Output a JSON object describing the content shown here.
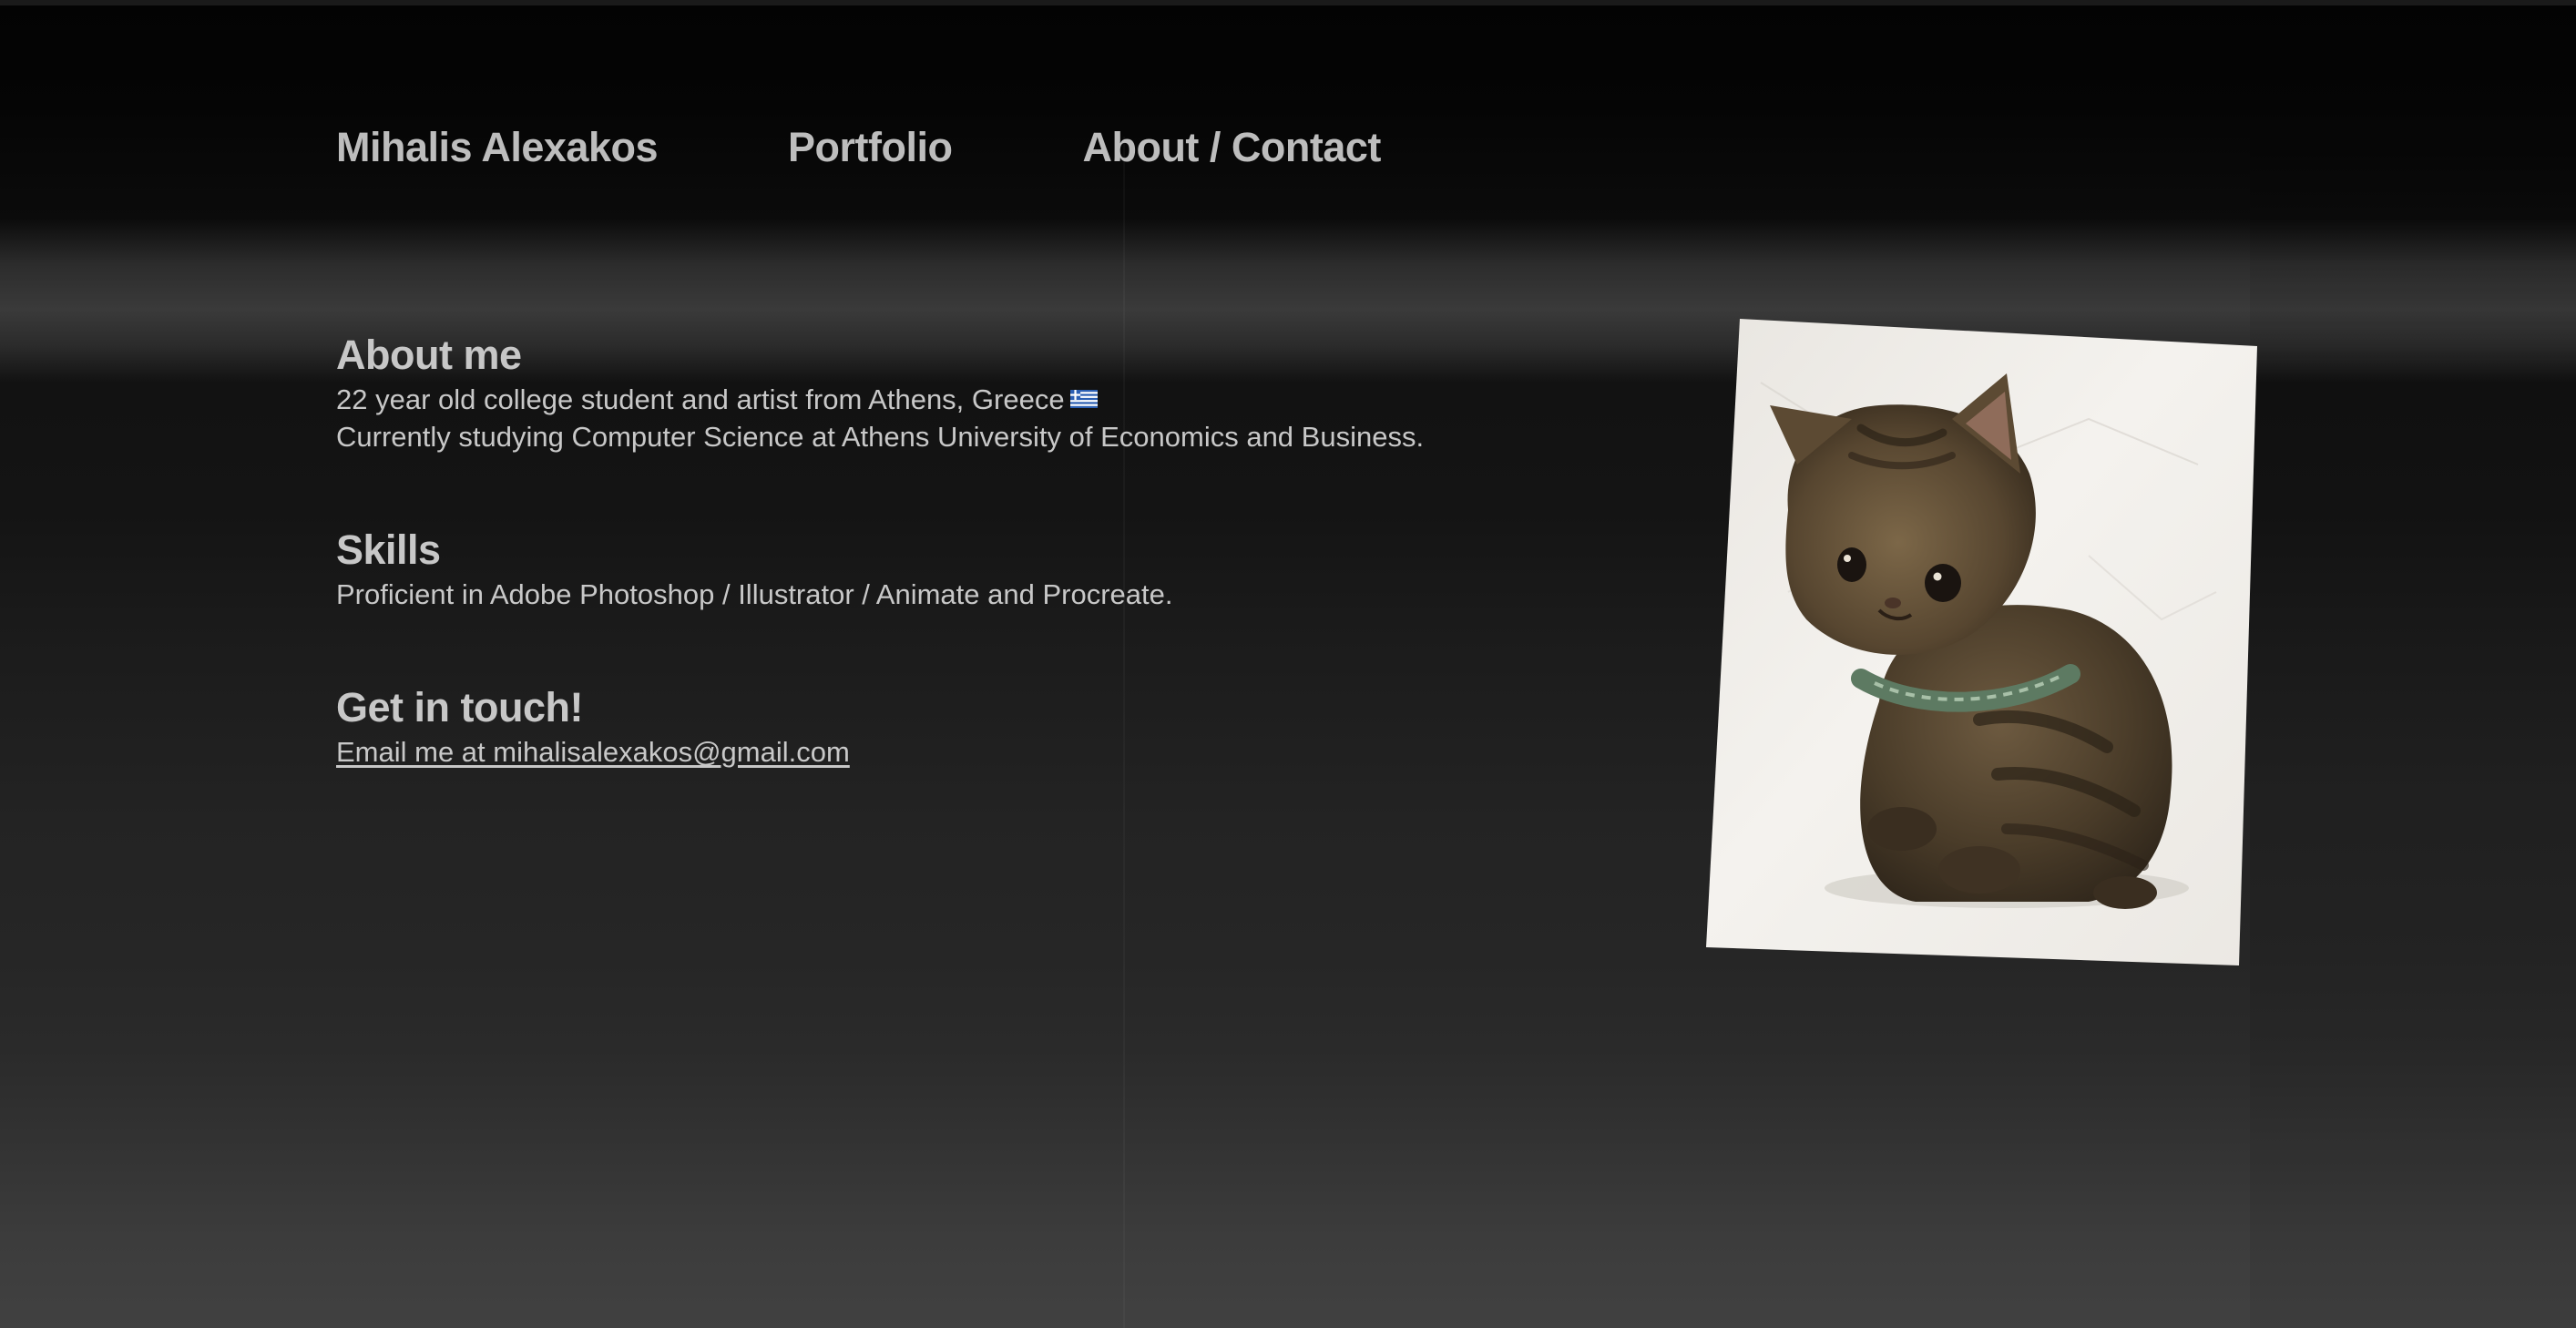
{
  "nav": {
    "site_name": "Mihalis Alexakos",
    "portfolio_label": "Portfolio",
    "about_contact_label": "About / Contact"
  },
  "about": {
    "heading": "About me",
    "line1": "22 year old college student and artist from Athens, Greece",
    "line2": "Currently studying Computer Science at Athens University of Economics and Business."
  },
  "skills": {
    "heading": "Skills",
    "text": "Proficient in Adobe Photoshop / Illustrator / Animate and Procreate."
  },
  "contact": {
    "heading": "Get in touch!",
    "email_link_text": "Email me at mihalisalexakos@gmail.com"
  },
  "icons": {
    "flag": "greece-flag-icon"
  },
  "colors": {
    "text": "#c4c4c4",
    "background_top": "#030303",
    "background_bottom": "#414141",
    "paper": "#f1efeb"
  }
}
